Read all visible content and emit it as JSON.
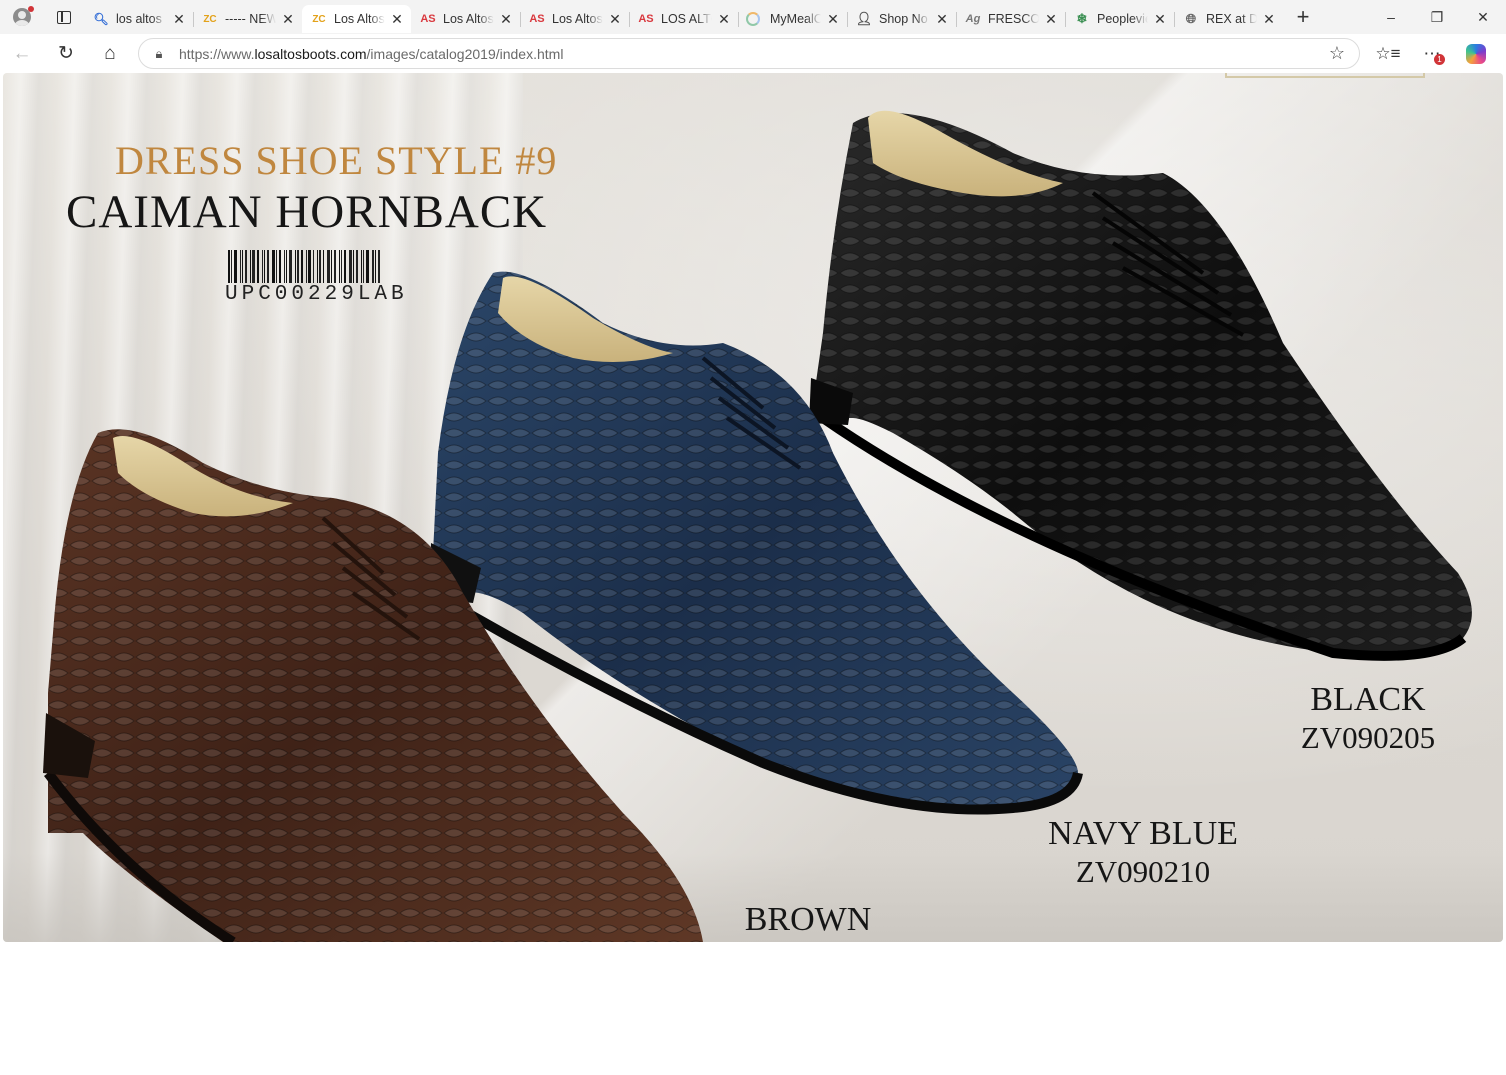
{
  "browser": {
    "tabs": [
      {
        "icon": "search-icon",
        "title": "los altos",
        "active": false
      },
      {
        "icon": "zc-icon",
        "title": "----- NEW",
        "active": false
      },
      {
        "icon": "zc-icon",
        "title": "Los Altos",
        "active": true
      },
      {
        "icon": "as-icon",
        "title": "Los Altos",
        "active": false
      },
      {
        "icon": "as-icon",
        "title": "Los Altos",
        "active": false
      },
      {
        "icon": "as-icon",
        "title": "LOS ALTOS",
        "active": false
      },
      {
        "icon": "ring-icon",
        "title": "MyMealC",
        "active": false
      },
      {
        "icon": "person-icon",
        "title": "Shop No",
        "active": false
      },
      {
        "icon": "ink-icon",
        "title": "FRESCO",
        "active": false
      },
      {
        "icon": "leaf-icon",
        "title": "Peoplevie",
        "active": false
      },
      {
        "icon": "globe-icon",
        "title": "REX at D",
        "active": false
      }
    ],
    "url_prefix": "https://www.",
    "url_domain": "losaltosboots.com",
    "url_path": "/images/catalog2019/index.html",
    "notification_count": "1"
  },
  "catalog": {
    "style_title": "DRESS SHOE STYLE #9",
    "model_name": "CAIMAN HORNBACK",
    "upc": "UPC00229LAB",
    "colors": [
      {
        "name": "BLACK",
        "sku": "ZV090205",
        "hex": "#141414"
      },
      {
        "name": "NAVY BLUE",
        "sku": "ZV090210",
        "hex": "#1f3350"
      },
      {
        "name": "BROWN",
        "sku": "",
        "hex": "#4b2a1c"
      }
    ],
    "accent_color": "#c0873f"
  }
}
